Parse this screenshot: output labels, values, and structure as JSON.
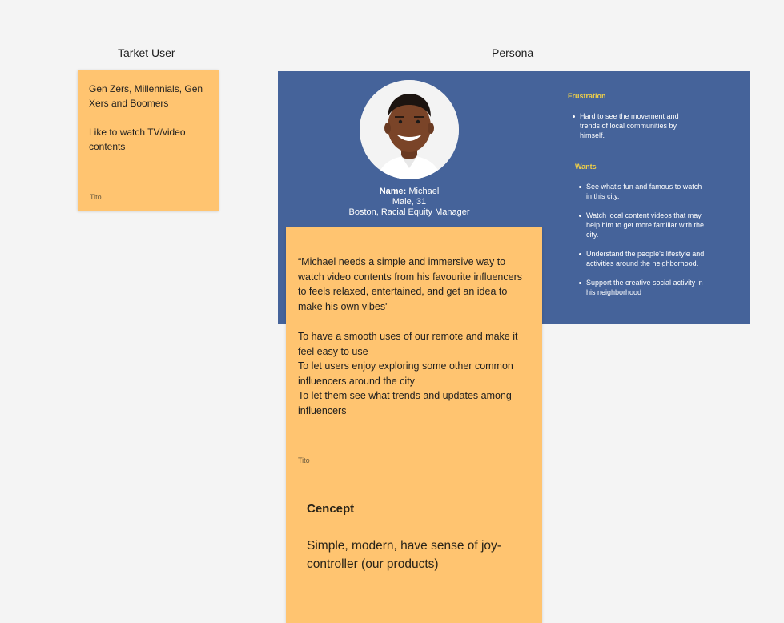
{
  "labels": {
    "target": "Tarket User",
    "persona": "Persona"
  },
  "target_note": {
    "line1": "Gen Zers, Millennials, Gen Xers and Boomers",
    "line2": "Like to watch TV/video contents",
    "author": "Tito"
  },
  "persona": {
    "name_label": "Name:",
    "name": "Michael",
    "gender_age": "Male, 31",
    "location_role": "Boston, Racial Equity Manager",
    "frustration_title": "Frustration",
    "frustrations": [
      "Hard to see the movement and trends of local communities by himself."
    ],
    "wants_title": "Wants",
    "wants": [
      "See what's fun and famous to watch in this city.",
      "Watch local content videos that may help him to get more familiar with the city.",
      "Understand the people's lifestyle and activities around the neighborhood.",
      "Support the creative social activity in his neighborhood"
    ],
    "colors": {
      "card": "#45639a",
      "heading": "#f0d048",
      "sticky": "#ffc470"
    }
  },
  "persona_note": {
    "quote": "“Michael needs a simple and immersive way to watch video contents from his favourite influencers to feels relaxed, entertained, and get an idea to make his own vibes\"",
    "goal1": "To have a smooth uses of our remote and make it feel easy to use",
    "goal2": "To let users enjoy exploring some other common influencers around the city",
    "goal3": "To let them see what trends and updates among influencers",
    "author": "Tito",
    "concept_title": "Cencept",
    "concept_body": "Simple, modern, have sense of joy-controller (our products)"
  }
}
